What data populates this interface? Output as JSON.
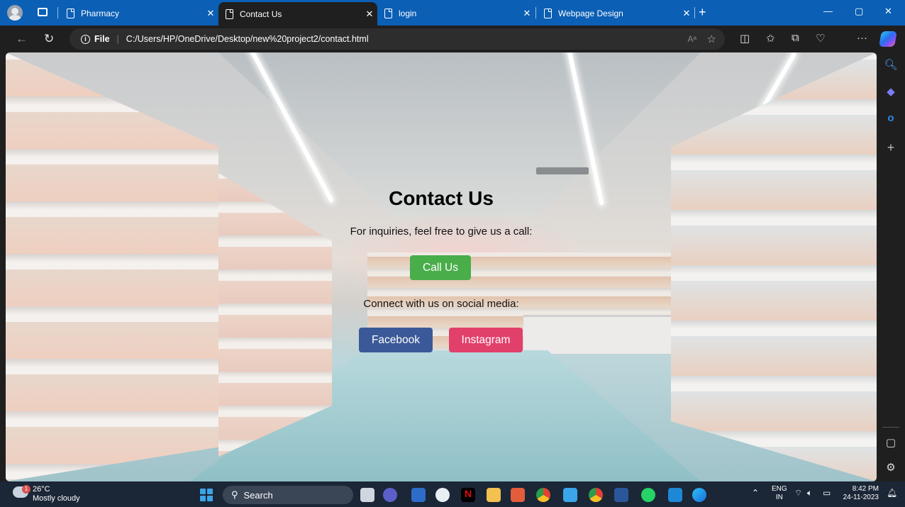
{
  "browser": {
    "tabs": [
      {
        "title": "Pharmacy",
        "active": false
      },
      {
        "title": "Contact Us",
        "active": true
      },
      {
        "title": "login",
        "active": false
      },
      {
        "title": "Webpage Design",
        "active": false
      }
    ],
    "address": {
      "scheme_label": "File",
      "url": "C:/Users/HP/OneDrive/Desktop/new%20project2/contact.html"
    },
    "accent_color": "#0b5fb5"
  },
  "page": {
    "heading": "Contact Us",
    "call_text": "For inquiries, feel free to give us a call:",
    "call_button": "Call Us",
    "social_text": "Connect with us on social media:",
    "facebook_button": "Facebook",
    "instagram_button": "Instagram",
    "colors": {
      "call_button": "#49ad4a",
      "facebook_button": "#3b5998",
      "instagram_button": "#e1406b"
    }
  },
  "taskbar": {
    "weather": {
      "temp": "26°C",
      "desc": "Mostly cloudy",
      "badge": "1"
    },
    "search_placeholder": "Search",
    "language": {
      "line1": "ENG",
      "line2": "IN"
    },
    "clock": {
      "time": "8:42 PM",
      "date": "24-11-2023"
    }
  }
}
